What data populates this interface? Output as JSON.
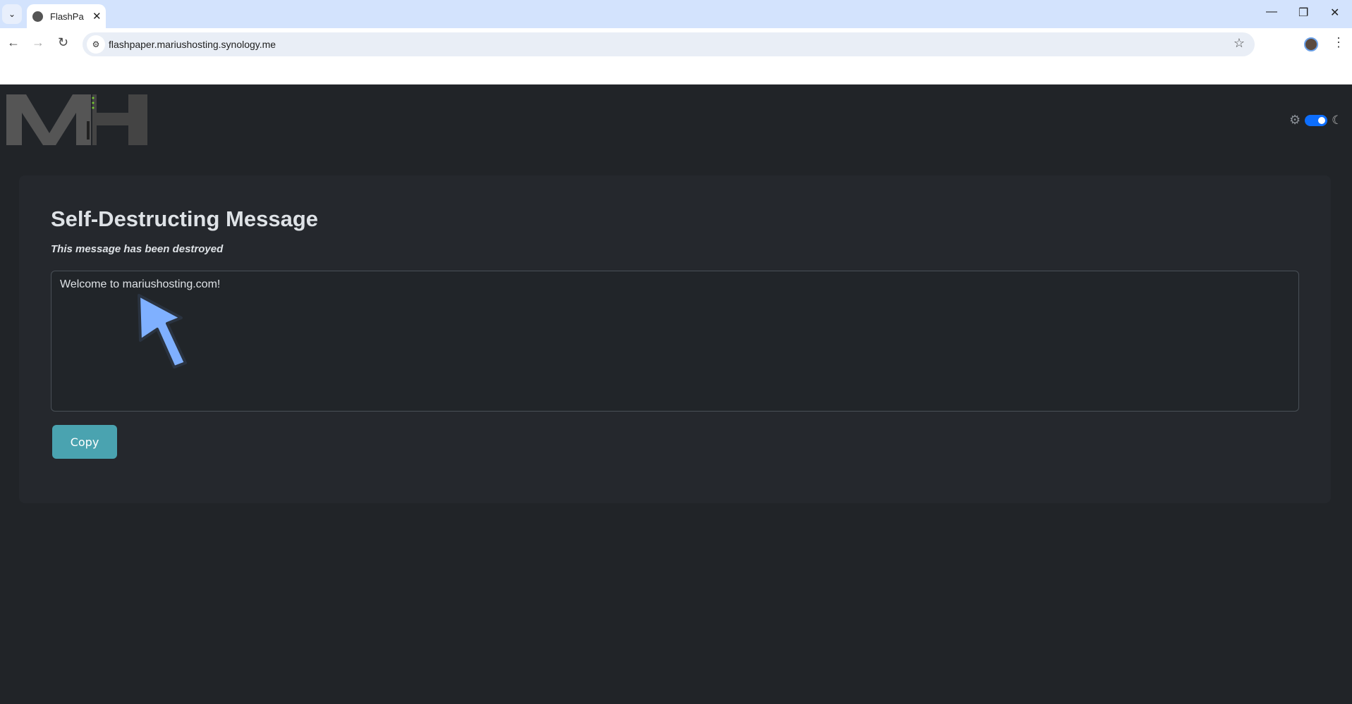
{
  "browser": {
    "tab_title": "FlashPaper",
    "url": "flashpaper.mariushosting.synology.me"
  },
  "page": {
    "logo_text": "MH",
    "title": "Self-Destructing Message",
    "subtitle": "This message has been destroyed",
    "message": "Welcome to mariushosting.com!",
    "copy_label": "Copy",
    "dark_mode_on": true
  },
  "colors": {
    "accent": "#4aa3b0",
    "toggle": "#0d6efd",
    "background": "#212428",
    "annotation_arrow": "#7fb0ff"
  }
}
